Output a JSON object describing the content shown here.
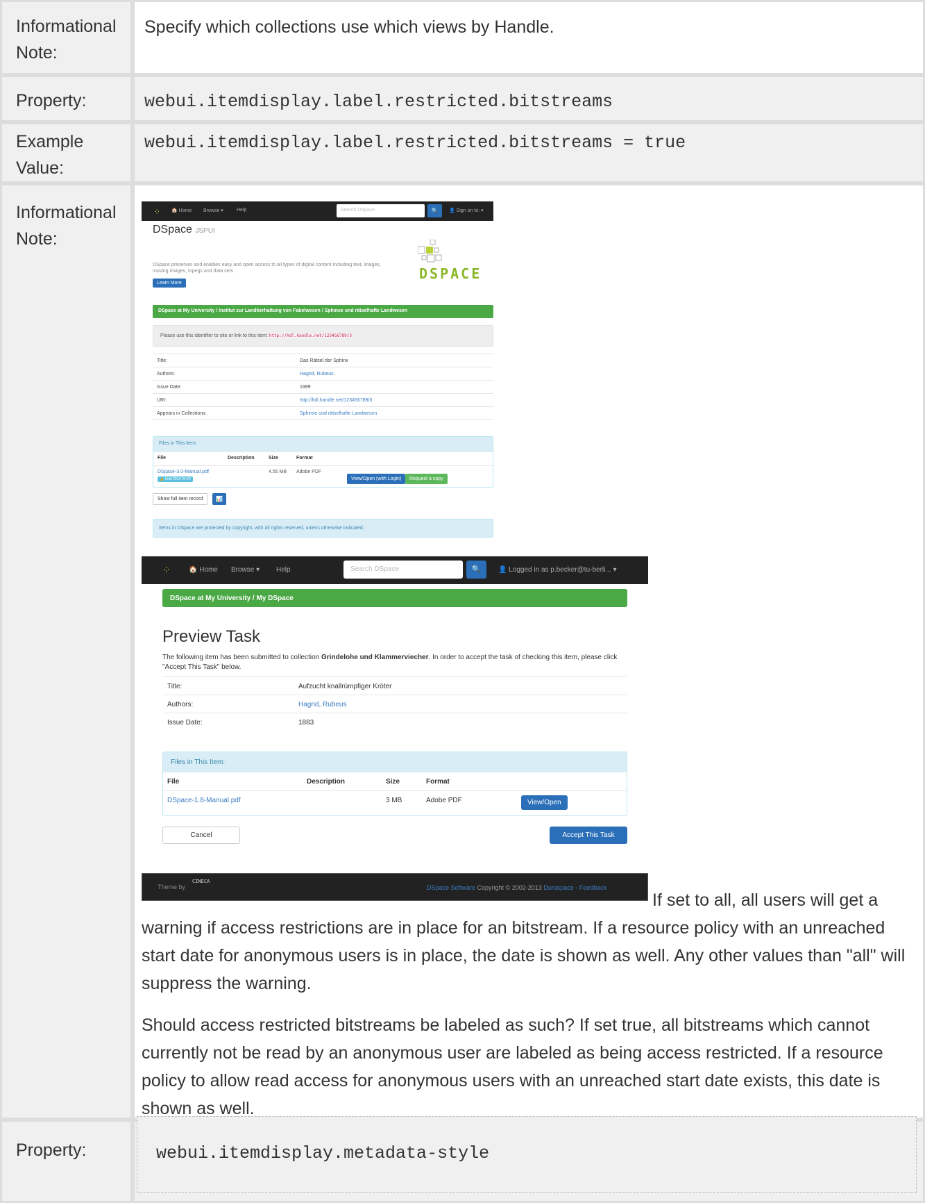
{
  "rows": [
    {
      "label": "Informational Note:",
      "text": "Specify which collections use which views by Handle."
    },
    {
      "label": "Property:",
      "value": "webui.itemdisplay.label.restricted.bitstreams"
    },
    {
      "label": "Example Value:",
      "value": "webui.itemdisplay.label.restricted.bitstreams = true"
    },
    {
      "label": "Informational Note:"
    },
    {
      "label": "Property:",
      "value": "webui.itemdisplay.metadata-style"
    }
  ],
  "labels": {
    "informational": "Informational",
    "note": "Note:",
    "property": "Property:",
    "example": "Example",
    "value": "Value:"
  },
  "shot1": {
    "nav": {
      "logo": "⁘",
      "home": "🏠 Home",
      "browse": "Browse ▾",
      "help": "Help",
      "search_placeholder": "Search DSpace",
      "search_icon": "🔍",
      "signon": "👤 Sign on to: ▾"
    },
    "title": "DSpace",
    "title_small": "JSPUI",
    "description": "DSpace preserves and enables easy and open access to all types of digital content including text, images, moving images, mpegs and data sets",
    "learn_more": "Learn More",
    "logo_word": "DSPACE",
    "breadcrumb": "DSpace at My University  /  Institut zur Landtierhaltung von Fabelwesen  /  Sphinxe und rätselhafte Landwesen",
    "handle_text": "Please use this identifier to cite or link to this item:",
    "handle_url": "http://hdl.handle.net/123456789/3",
    "metadata": [
      {
        "k": "Title:",
        "v": "Das Rätsel der Sphinx",
        "link": false
      },
      {
        "k": "Authors:",
        "v": "Hagrid, Rubeus",
        "link": true
      },
      {
        "k": "Issue Date:",
        "v": "1999",
        "link": false
      },
      {
        "k": "URI:",
        "v": "http://hdl.handle.net/123456789/3",
        "link": true
      },
      {
        "k": "Appears in Collections:",
        "v": "Sphinxe und rätselhafte Landwesen",
        "link": true
      }
    ],
    "files_heading": "Files in This Item:",
    "columns": [
      "File",
      "Description",
      "Size",
      "Format"
    ],
    "file": {
      "name": "DSpace-3.0-Manual.pdf",
      "embargo": "🔒 Until 2015-04-23",
      "size": "4.55 MB",
      "format": "Adobe PDF",
      "view": "View/Open (with Login)",
      "request": "Request a copy"
    },
    "show_full": "Show full item record",
    "stats_icon": "📊",
    "copyright": "Items in DSpace are protected by copyright, with all rights reserved, unless otherwise indicated."
  },
  "shot2": {
    "nav": {
      "logo": "⁘",
      "home": "🏠 Home",
      "browse": "Browse ▾",
      "help": "Help",
      "search_placeholder": "Search DSpace",
      "search_icon": "🔍",
      "user": "👤 Logged in as p.becker@tu-berli... ▾"
    },
    "breadcrumb": "DSpace at My University  /  My DSpace",
    "title": "Preview Task",
    "intro_before": "The following item has been submitted to collection ",
    "intro_collection": "Grindelohe und Klammerviecher",
    "intro_after": ". In order to accept the task of checking this item, please click \"Accept This Task\" below.",
    "metadata": [
      {
        "k": "Title:",
        "v": "Aufzucht knallrümpfiger Kröter",
        "link": false
      },
      {
        "k": "Authors:",
        "v": "Hagrid, Rubeus",
        "link": true
      },
      {
        "k": "Issue Date:",
        "v": "1883",
        "link": false
      }
    ],
    "files_heading": "Files in This Item:",
    "columns": [
      "File",
      "Description",
      "Size",
      "Format"
    ],
    "file": {
      "name": "DSpace-1.8-Manual.pdf",
      "size": "3 MB",
      "format": "Adobe PDF",
      "view": "View/Open"
    },
    "cancel": "Cancel",
    "accept": "Accept This Task",
    "footer": {
      "theme_by": "Theme by",
      "cineca": "CINECA",
      "software": "DSpace Software",
      "copyright": " Copyright © 2002-2013 ",
      "duraspace": "Duraspace",
      "sep": " - ",
      "feedback": "Feedback"
    }
  },
  "note_inline": "If set to all, all users will get a",
  "note_rest": "warning if access restrictions are in place for an bitstream. If a resource policy with an unreached start date for anonymous users is in place, the date is shown as well. Any other values than \"all\" will suppress the warning.",
  "note_second": "Should access restricted bitstreams be labeled as such? If set true, all bitstreams which cannot currently not be read by an anonymous user are labeled as being access restricted. If a resource policy to allow read access for anonymous users with an unreached start date exists, this date is shown as well."
}
